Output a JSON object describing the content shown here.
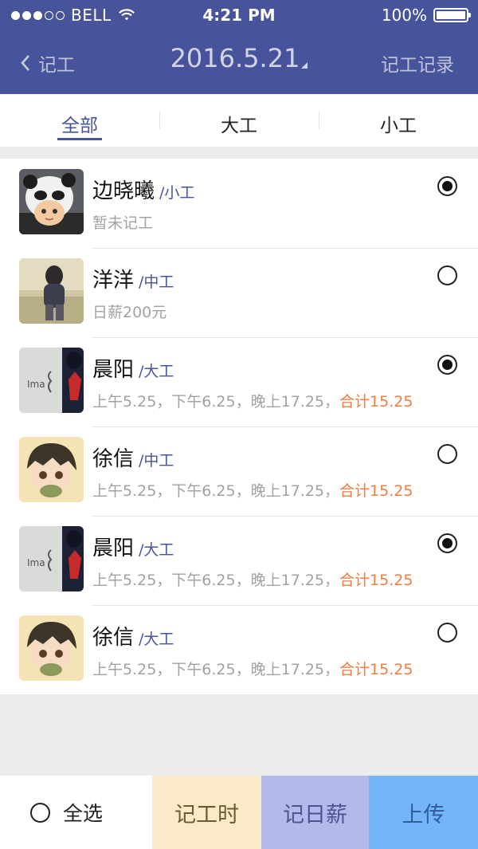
{
  "status_bar": {
    "carrier": "BELL",
    "time": "4:21 PM",
    "battery": "100%"
  },
  "nav": {
    "back_label": "记工",
    "date": "2016.5.21",
    "right_link": "记工记录"
  },
  "tabs": [
    {
      "label": "全部",
      "active": true
    },
    {
      "label": "大工",
      "active": false
    },
    {
      "label": "小工",
      "active": false
    }
  ],
  "workers": [
    {
      "name": "边晓曦",
      "level": "/小工",
      "detail": "暂未记工",
      "total": "",
      "selected": true,
      "avatar": "panda-avatar"
    },
    {
      "name": "洋洋",
      "level": "/中工",
      "detail": "日薪200元",
      "total": "",
      "selected": false,
      "avatar": "girl-photo-avatar"
    },
    {
      "name": "晨阳",
      "level": "/大工",
      "detail": "上午5.25，下午6.25，晚上17.25，",
      "total": "合计15.25",
      "selected": true,
      "avatar": "wall-photo-avatar"
    },
    {
      "name": "徐信",
      "level": "/中工",
      "detail": "上午5.25，下午6.25，晚上17.25，",
      "total": "合计15.25",
      "selected": false,
      "avatar": "anime-boy-avatar"
    },
    {
      "name": "晨阳",
      "level": "/大工",
      "detail": "上午5.25，下午6.25，晚上17.25，",
      "total": "合计15.25",
      "selected": true,
      "avatar": "wall-photo-avatar"
    },
    {
      "name": "徐信",
      "level": "/大工",
      "detail": "上午5.25，下午6.25，晚上17.25，",
      "total": "合计15.25",
      "selected": false,
      "avatar": "anime-boy-avatar"
    }
  ],
  "bottom_bar": {
    "select_all": "全选",
    "record_hours": "记工时",
    "record_daily": "记日薪",
    "upload": "上传"
  },
  "colors": {
    "header": "#47549b",
    "accent_total": "#f07d40",
    "record_hours_bg": "#fbeac8",
    "record_daily_bg": "#b3b9eb",
    "upload_bg": "#74b4f8"
  }
}
